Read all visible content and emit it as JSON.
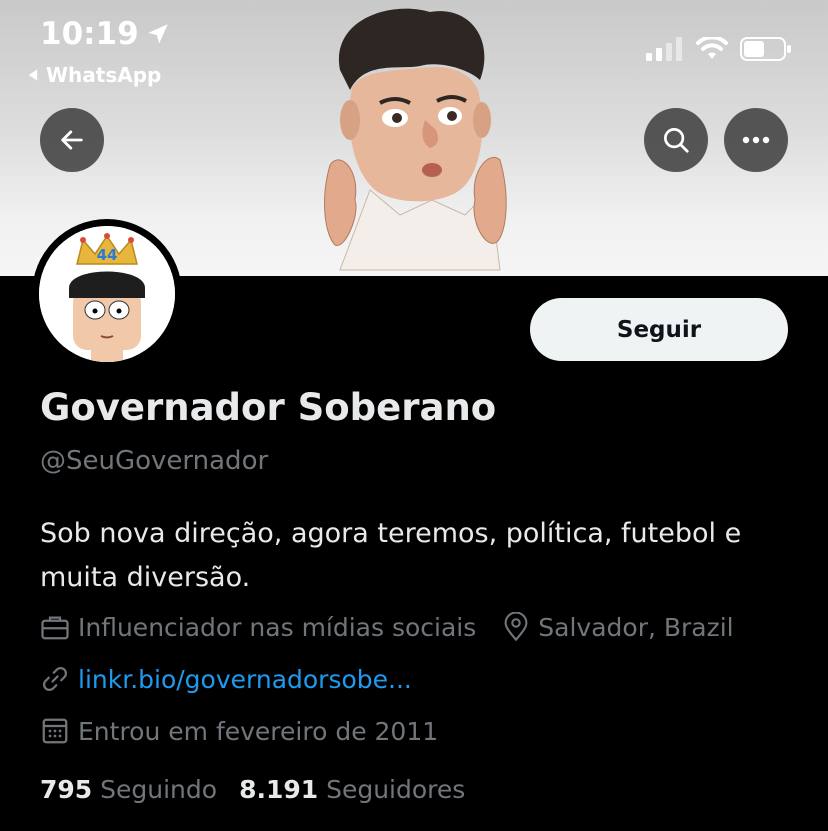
{
  "status_bar": {
    "time": "10:19",
    "back_app": "WhatsApp"
  },
  "profile": {
    "display_name": "Governador Soberano",
    "handle": "@SeuGovernador",
    "bio": "Sob nova direção, agora teremos, política, futebol e muita diversão.",
    "category": "Influenciador nas mídias sociais",
    "location": "Salvador, Brazil",
    "link": "linkr.bio/governadorsobe...",
    "joined": "Entrou em fevereiro de 2011",
    "following_count": "795",
    "following_label": "Seguindo",
    "followers_count": "8.191",
    "followers_label": "Seguidores",
    "crown_number": "44"
  },
  "actions": {
    "follow_label": "Seguir"
  },
  "icons": {
    "back": "arrow-left-icon",
    "search": "search-icon",
    "more": "more-horizontal-icon",
    "category": "briefcase-icon",
    "location": "location-pin-icon",
    "link": "link-icon",
    "joined": "calendar-icon"
  },
  "colors": {
    "background": "#000000",
    "text_primary": "#e7e9ea",
    "text_secondary": "#71767b",
    "link": "#1d9bf0",
    "follow_button": "#eff3f4"
  }
}
